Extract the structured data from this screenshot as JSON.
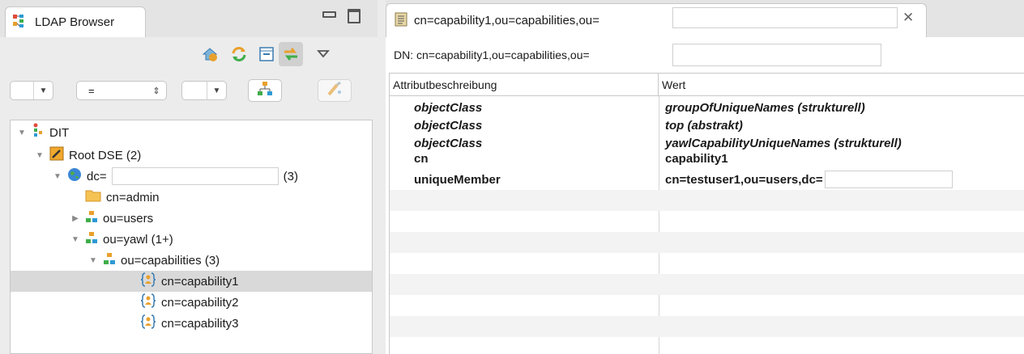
{
  "left_panel": {
    "tab_title": "LDAP Browser",
    "toolbar_icons": [
      "home-icon",
      "refresh-icon",
      "collapse-all-icon",
      "link-with-editor-icon",
      "view-menu-icon"
    ],
    "filter": {
      "attribute_value": "",
      "operator_value": "=",
      "value_value": "",
      "buttons": [
        "tree-filter-icon",
        "clear-filter-icon"
      ]
    },
    "tree": {
      "root": "DIT",
      "root_dse": "Root DSE (2)",
      "dc_prefix": "dc=",
      "dc_count": "(3)",
      "admin": "cn=admin",
      "users": "ou=users",
      "yawl": "ou=yawl (1+)",
      "capabilities": "ou=capabilities (3)",
      "cap1": "cn=capability1",
      "cap2": "cn=capability2",
      "cap3": "cn=capability3"
    }
  },
  "editor": {
    "tab_title": "cn=capability1,ou=capabilities,ou=",
    "close_symbol": "✕",
    "dn_text": "DN: cn=capability1,ou=capabilities,ou=",
    "columns": {
      "attribute": "Attributbeschreibung",
      "value": "Wert"
    },
    "rows": [
      {
        "name": "objectClass",
        "value": "groupOfUniqueNames (strukturell)",
        "italic": true
      },
      {
        "name": "objectClass",
        "value": "top (abstrakt)",
        "italic": true
      },
      {
        "name": "objectClass",
        "value": "yawlCapabilityUniqueNames (strukturell)",
        "italic": true
      },
      {
        "name": "cn",
        "value": "capability1",
        "italic": false
      },
      {
        "name": "uniqueMember",
        "value": "cn=testuser1,ou=users,dc=",
        "italic": false
      }
    ]
  },
  "colors": {
    "chrome_bg": "#ececec",
    "selection": "#d9d9d9",
    "stripe": "#f3f3f3"
  }
}
